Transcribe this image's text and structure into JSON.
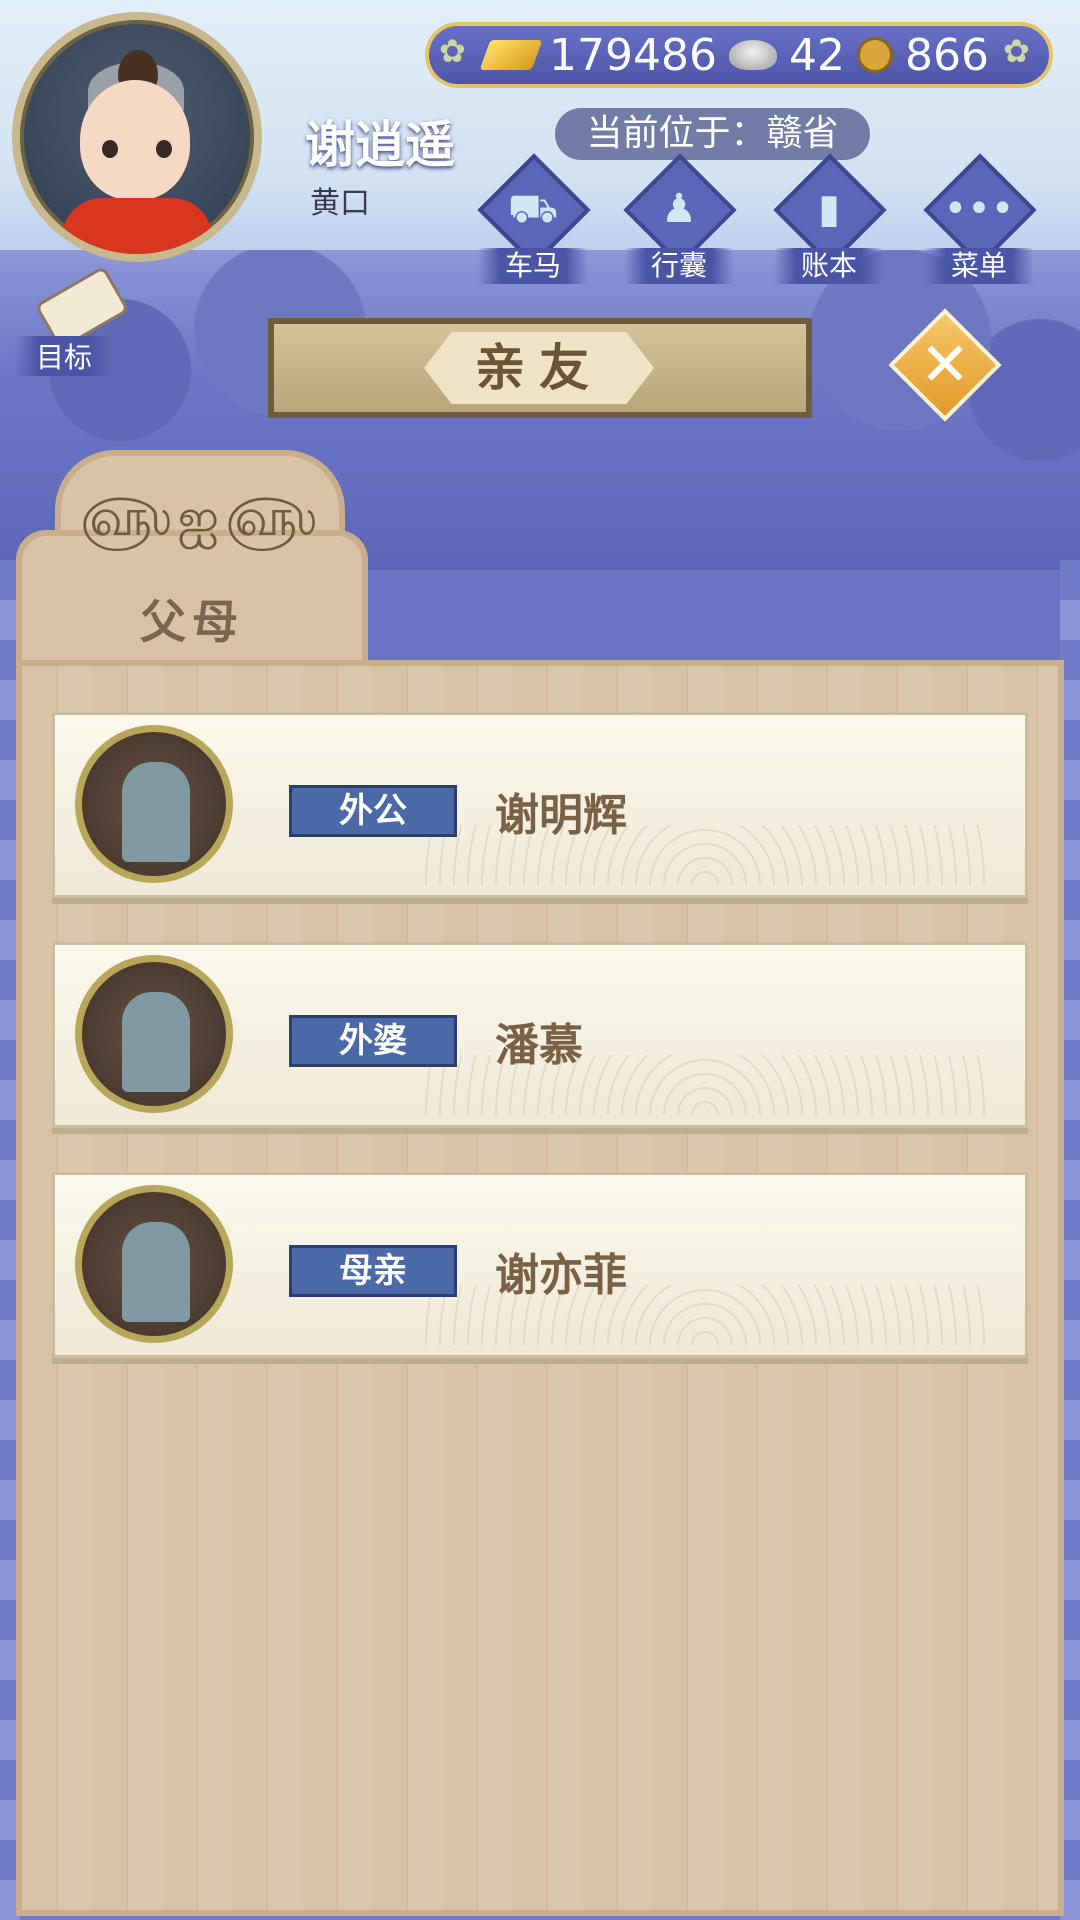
{
  "player": {
    "name": "谢逍遥",
    "title": "黄口"
  },
  "currency": {
    "gold": "179486",
    "silver": "42",
    "copper": "866"
  },
  "location": {
    "text": "当前位于：赣省"
  },
  "menu": [
    {
      "label": "车马",
      "icon": "carriage-icon"
    },
    {
      "label": "行囊",
      "icon": "bundle-icon"
    },
    {
      "label": "账本",
      "icon": "ledger-icon"
    },
    {
      "label": "菜单",
      "icon": "more-icon"
    }
  ],
  "goal": {
    "label": "目标"
  },
  "header": {
    "title": "亲友"
  },
  "tab": {
    "label": "父母"
  },
  "relatives": [
    {
      "relation": "外公",
      "name": "谢明辉"
    },
    {
      "relation": "外婆",
      "name": "潘慕"
    },
    {
      "relation": "母亲",
      "name": "谢亦菲"
    }
  ],
  "colors": {
    "accent_gold": "#e4c466",
    "badge_blue": "#4a69a6",
    "panel_wood": "#d8c3a7",
    "background_blue": "#6b74c4"
  }
}
